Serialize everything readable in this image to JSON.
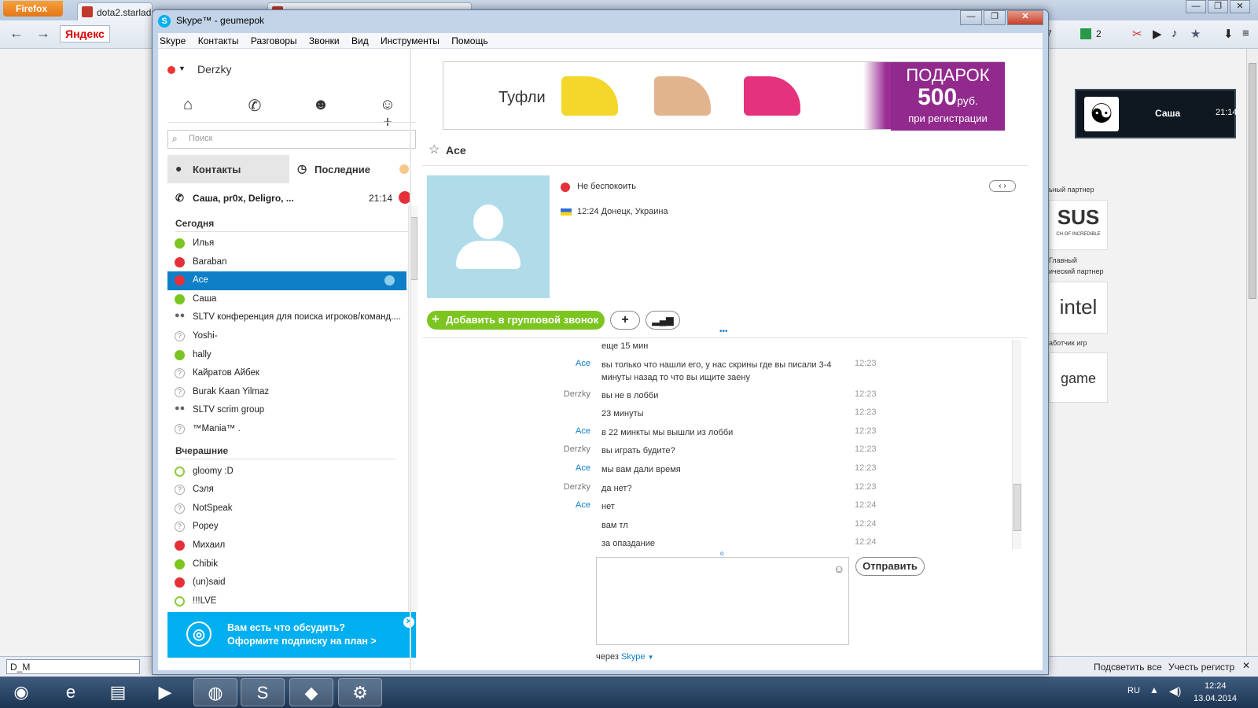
{
  "browser": {
    "menu_button": "Firefox",
    "tab1": "dota2.starlad",
    "address_brand": "Яндекс",
    "counter": "+7",
    "counter2": "2",
    "find_value": "D_M",
    "find_highlight_all": "Подсветить все",
    "find_match_case": "Учесть регистр",
    "sponsors": [
      "ьный партнер",
      "Главный",
      "ический партнер",
      "аботчик игр"
    ],
    "sponsor_logos": [
      "SUS",
      "intel",
      "game"
    ],
    "asus_tagline": "CH OF INCREDIBLE"
  },
  "notification": {
    "name": "Саша",
    "time": "21:14"
  },
  "taskbar": {
    "lang": "RU",
    "time": "12:24",
    "date": "13.04.2014"
  },
  "skype": {
    "title": "Skype™ - geumepok",
    "menu": [
      "Skype",
      "Контакты",
      "Разговоры",
      "Звонки",
      "Вид",
      "Инструменты",
      "Помощь"
    ],
    "me": "Derzky",
    "search_placeholder": "Поиск",
    "tab_contacts": "Контакты",
    "tab_recent": "Последние",
    "pinned": {
      "label": "Саша, pr0x, Deligro, ...",
      "time": "21:14"
    },
    "group_today": "Сегодня",
    "group_yesterday": "Вчерашние",
    "today": [
      {
        "name": "Илья",
        "status": "online"
      },
      {
        "name": "Baraban",
        "status": "dnd"
      },
      {
        "name": "Ace",
        "status": "dnd",
        "selected": true
      },
      {
        "name": "Саша",
        "status": "online"
      },
      {
        "name": "SLTV конференция для поиска игроков/команд....",
        "status": "group"
      },
      {
        "name": "Yoshi-",
        "status": "unknown"
      },
      {
        "name": "hally",
        "status": "online"
      },
      {
        "name": "Кайратов Айбек",
        "status": "unknown"
      },
      {
        "name": "Burak Kaan Yilmaz",
        "status": "unknown"
      },
      {
        "name": "SLTV scrim group",
        "status": "group"
      },
      {
        "name": "™Mania™ .",
        "status": "unknown"
      }
    ],
    "yesterday": [
      {
        "name": "gloomy :D",
        "status": "away-empty"
      },
      {
        "name": "Сэля",
        "status": "unknown"
      },
      {
        "name": "NotSpeak",
        "status": "unknown"
      },
      {
        "name": "Popey",
        "status": "unknown"
      },
      {
        "name": "Михаил",
        "status": "dnd"
      },
      {
        "name": "Chibik",
        "status": "online"
      },
      {
        "name": "(un)said",
        "status": "dnd"
      },
      {
        "name": "!!!LVE",
        "status": "away-empty"
      }
    ],
    "promo_line1": "Вам есть что обсудить?",
    "promo_line2": "Оформите подписку на план >",
    "ad": {
      "text": "Туфли",
      "gift1": "ПОДАРОК",
      "gift2": "500",
      "gift_unit": "руб.",
      "gift3": "при регистрации"
    },
    "contact": {
      "name": "Ace",
      "status_text": "Не беспокоить",
      "location": "12:24 Донецк, Украина",
      "add_group_call": "Добавить в групповой звонок"
    },
    "messages": [
      {
        "who": "",
        "text": "еще 15 мин",
        "time": ""
      },
      {
        "who": "Ace",
        "text": "вы только что нашли его, у нас скрины где вы писали 3-4 минуты назад то что вы ищите заену",
        "time": "12:23"
      },
      {
        "who": "Derzky",
        "text": "вы не в лобби",
        "time": "12:23"
      },
      {
        "who": "",
        "text": "23  минуты",
        "time": "12:23"
      },
      {
        "who": "Ace",
        "text": "в 22 минкты мы вышли из лобби",
        "time": "12:23"
      },
      {
        "who": "Derzky",
        "text": "вы играть будите?",
        "time": "12:23"
      },
      {
        "who": "Ace",
        "text": "мы вам дали время",
        "time": "12:23"
      },
      {
        "who": "Derzky",
        "text": "да нет?",
        "time": "12:23"
      },
      {
        "who": "Ace",
        "text": "нет",
        "time": "12:24"
      },
      {
        "who": "",
        "text": "вам тл",
        "time": "12:24"
      },
      {
        "who": "",
        "text": "за опаздание",
        "time": "12:24"
      }
    ],
    "send": "Отправить",
    "via": "через",
    "via_link": "Skype"
  },
  "colors": {
    "skype_blue": "#00aff0",
    "select": "#0f7fc8",
    "online": "#7cc520",
    "dnd": "#e5303a"
  }
}
